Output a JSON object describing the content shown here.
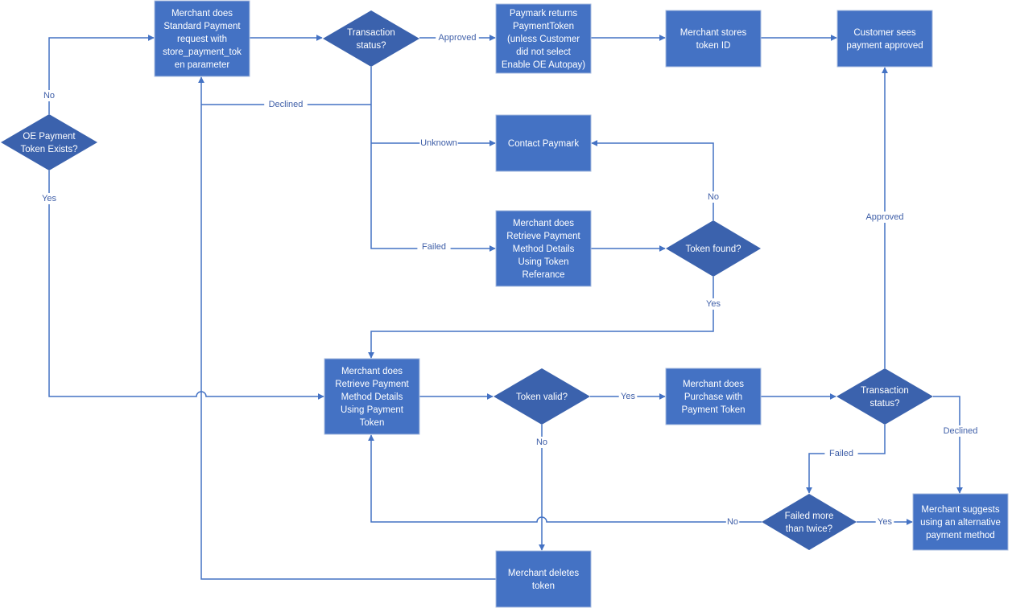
{
  "colors": {
    "box": "#4472C4",
    "decision": "#3B62AD",
    "connector": "#4472C4",
    "label": "#3F5FA8"
  },
  "nodes": {
    "oe_token_exists": {
      "shape": "decision",
      "lines": [
        "OE Payment",
        "Token Exists?"
      ]
    },
    "standard_payment": {
      "shape": "process",
      "lines": [
        "Merchant does",
        "Standard Payment",
        "request with",
        "store_payment_tok",
        "en parameter"
      ]
    },
    "transaction_status_1": {
      "shape": "decision",
      "lines": [
        "Transaction",
        "status?"
      ]
    },
    "paymark_returns": {
      "shape": "process",
      "lines": [
        "Paymark returns",
        "PaymentToken",
        "(unless Customer",
        "did not select",
        "Enable OE Autopay)"
      ]
    },
    "stores_token": {
      "shape": "process",
      "lines": [
        "Merchant stores",
        "token ID"
      ]
    },
    "customer_approved": {
      "shape": "process",
      "lines": [
        "Customer sees",
        "payment approved"
      ]
    },
    "contact_paymark": {
      "shape": "process",
      "lines": [
        "Contact Paymark"
      ]
    },
    "retrieve_by_reference": {
      "shape": "process",
      "lines": [
        "Merchant does",
        "Retrieve Payment",
        "Method Details",
        "Using Token",
        "Referance"
      ]
    },
    "token_found": {
      "shape": "decision",
      "lines": [
        "Token found?"
      ]
    },
    "retrieve_by_token": {
      "shape": "process",
      "lines": [
        "Merchant does",
        "Retrieve Payment",
        "Method Details",
        "Using Payment",
        "Token"
      ]
    },
    "token_valid": {
      "shape": "decision",
      "lines": [
        "Token valid?"
      ]
    },
    "purchase": {
      "shape": "process",
      "lines": [
        "Merchant does",
        "Purchase with",
        "Payment Token"
      ]
    },
    "transaction_status_2": {
      "shape": "decision",
      "lines": [
        "Transaction",
        "status?"
      ]
    },
    "failed_twice": {
      "shape": "decision",
      "lines": [
        "Failed more",
        "than twice?"
      ]
    },
    "suggest_alternative": {
      "shape": "process",
      "lines": [
        "Merchant suggests",
        "using an alternative",
        "payment method"
      ]
    },
    "deletes_token": {
      "shape": "process",
      "lines": [
        "Merchant deletes",
        "token"
      ]
    }
  },
  "edge_labels": {
    "oe_no": "No",
    "oe_yes": "Yes",
    "ts1_approved": "Approved",
    "ts1_declined": "Declined",
    "ts1_unknown": "Unknown",
    "ts1_failed": "Failed",
    "found_no": "No",
    "found_yes": "Yes",
    "valid_yes": "Yes",
    "valid_no": "No",
    "ts2_approved": "Approved",
    "ts2_declined": "Declined",
    "ts2_failed": "Failed",
    "twice_yes": "Yes",
    "twice_no": "No"
  }
}
